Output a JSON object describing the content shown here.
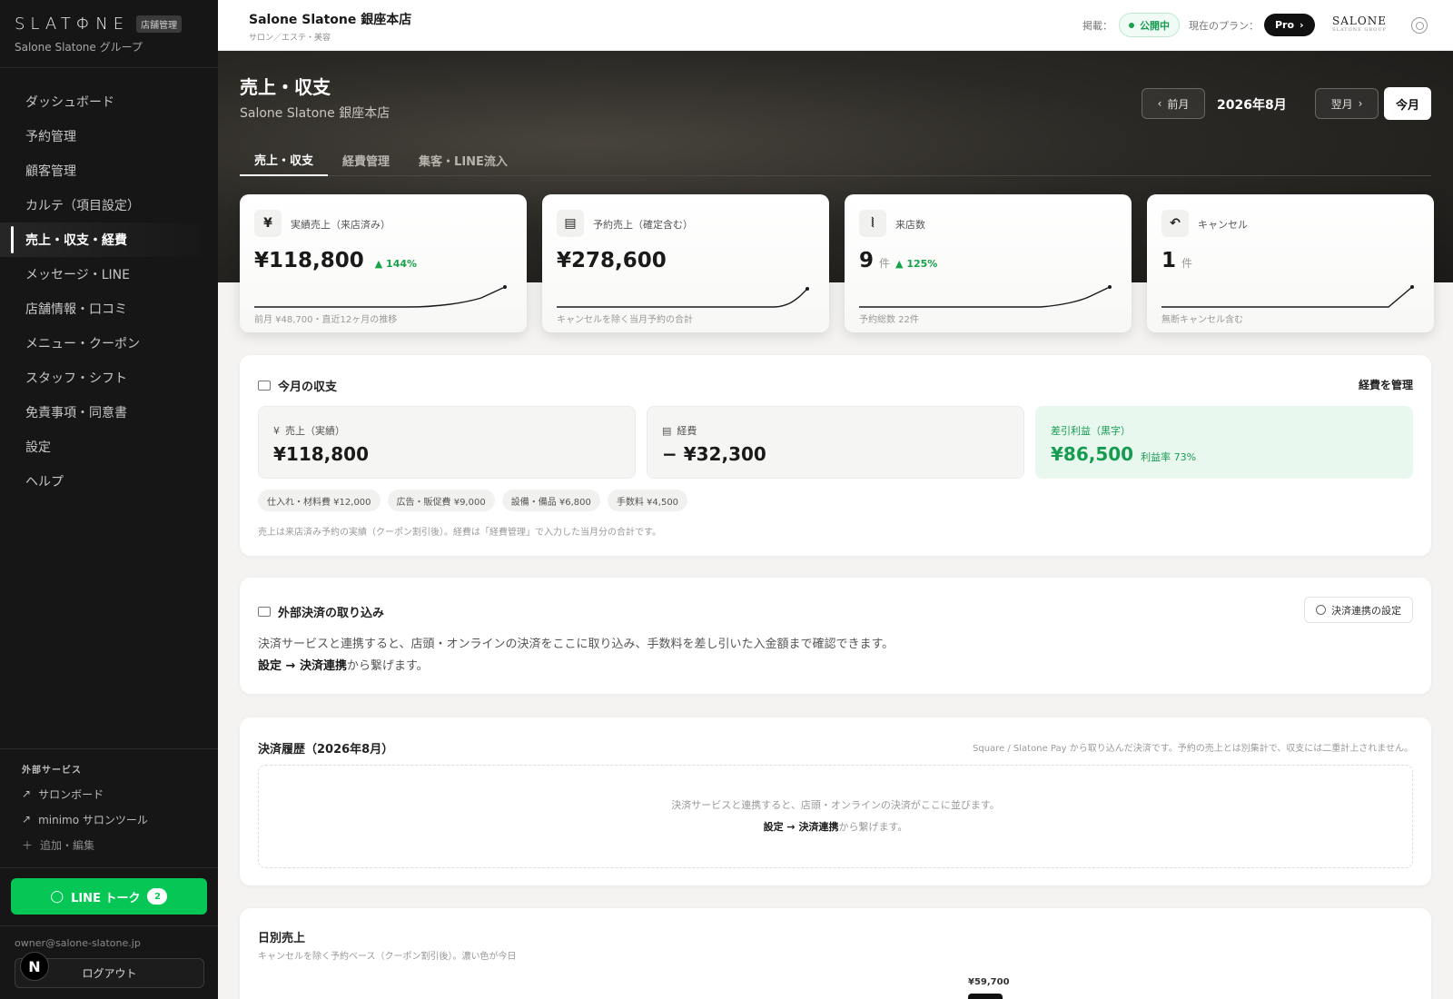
{
  "sidebar": {
    "logo": "SLATΦNE",
    "admin_badge": "店舗管理",
    "group": "Salone Slatone グループ",
    "nav": [
      "ダッシュボード",
      "予約管理",
      "顧客管理",
      "カルテ（項目設定）",
      "売上・収支・経費",
      "メッセージ・LINE",
      "店舗情報・口コミ",
      "メニュー・クーポン",
      "スタッフ・シフト",
      "免責事項・同意書",
      "設定",
      "ヘルプ"
    ],
    "active_index": 4,
    "external": {
      "title": "外部サービス",
      "items": [
        "サロンボード",
        "minimo サロンツール"
      ],
      "add": "追加・編集"
    },
    "line_button": "LINE トーク",
    "line_count": "2",
    "email": "owner@salone-slatone.jp",
    "logout": "ログアウト",
    "avatar": "N"
  },
  "topbar": {
    "store_name": "Salone Slatone 銀座本店",
    "store_category": "サロン／エステ・美容",
    "publish_label": "掲載：",
    "publish_status": "公開中",
    "plan_label": "現在のプラン：",
    "plan": "Pro",
    "brand_top": "SALONE",
    "brand_bottom": "SLATONE GROUP",
    "status_color": "#16a34a"
  },
  "header": {
    "title": "売上・収支",
    "subtitle": "Salone Slatone 銀座本店",
    "prev": "前月",
    "month": "2026年8月",
    "next": "翌月",
    "today": "今月"
  },
  "tabs": [
    "売上・収支",
    "経費管理",
    "集客・LINE流入"
  ],
  "kpis": [
    {
      "icon": "¥",
      "label": "実績売上（来店済み）",
      "value": "¥118,800",
      "unit": "",
      "delta": "▲ 144%",
      "note": "前月 ¥48,700・直近12ヶ月の推移"
    },
    {
      "icon": "▤",
      "label": "予約売上（確定含む）",
      "value": "¥278,600",
      "unit": "",
      "delta": "",
      "note": "キャンセルを除く当月予約の合計"
    },
    {
      "icon": "⦚",
      "label": "来店数",
      "value": "9",
      "unit": "件",
      "delta": "▲ 125%",
      "note": "予約総数 22件"
    },
    {
      "icon": "↶",
      "label": "キャンセル",
      "value": "1",
      "unit": "件",
      "delta": "",
      "note": "無断キャンセル含む"
    }
  ],
  "balance": {
    "title": "今月の収支",
    "manage": "経費を管理",
    "sales_label": "売上（実績）",
    "sales_value": "¥118,800",
    "expense_label": "経費",
    "expense_value": "− ¥32,300",
    "profit_label": "差引利益（黒字）",
    "profit_value": "¥86,500",
    "margin": "利益率 73%",
    "chips": [
      "仕入れ・材料費 ¥12,000",
      "広告・販促費 ¥9,000",
      "設備・備品 ¥6,800",
      "手数料 ¥4,500"
    ],
    "note": "売上は来店済み予約の実績（クーポン割引後）。経費は「経費管理」で入力した当月分の合計です。"
  },
  "external_pay": {
    "title": "外部決済の取り込み",
    "settings_button": "決済連携の設定",
    "line1": "決済サービスと連携すると、店頭・オンラインの決済をここに取り込み、手数料を差し引いた入金額まで確認できます。",
    "line2_bold": "設定 → 決済連携",
    "line2_rest": "から繋げます。"
  },
  "history": {
    "title": "決済履歴（2026年8月）",
    "note": "Square / Slatone Pay から取り込んだ決済です。予約の売上とは別集計で、収支には二重計上されません。",
    "empty1": "決済サービスと連携すると、店頭・オンラインの決済がここに並びます。",
    "empty2_bold": "設定 → 決済連携",
    "empty2_rest": "から繋げます。"
  },
  "daily": {
    "title": "日別売上",
    "subtitle": "キャンセルを除く予約ベース（クーポン割引後）。濃い色が今日",
    "bar_label": "¥59,700"
  }
}
